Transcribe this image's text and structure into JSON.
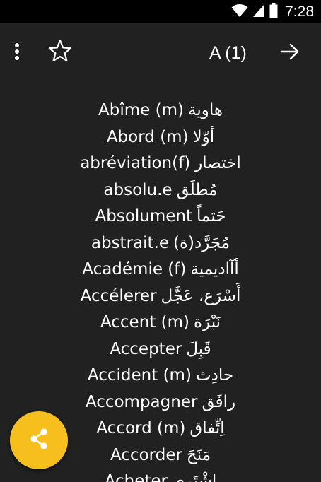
{
  "status_bar": {
    "time": "7:28",
    "icons": [
      "wifi-icon",
      "cell-signal-icon",
      "battery-icon"
    ]
  },
  "toolbar": {
    "menu_icon": "more-vert-icon",
    "favorite_icon": "star-outline-icon",
    "letter_title": "A (1)",
    "next_icon": "arrow-right-icon"
  },
  "words": [
    {
      "fr": "Abîme (m)",
      "ar": "هاوية"
    },
    {
      "fr": "Abord (m)",
      "ar": "أوّلا"
    },
    {
      "fr": "abréviation(f)",
      "ar": "اختصار"
    },
    {
      "fr": "absolu.e",
      "ar": "مُطلَق"
    },
    {
      "fr": "Absolument",
      "ar": "حَتماً"
    },
    {
      "fr": "abstrait.e",
      "ar": "مُجَرَّد(ة)"
    },
    {
      "fr": "Académie (f)",
      "ar": "أآاديمية"
    },
    {
      "fr": "Accélerer",
      "ar": "أَسْرَع، عَجَّل"
    },
    {
      "fr": "Accent (m)",
      "ar": "نَبْرَة"
    },
    {
      "fr": "Accepter",
      "ar": "قَبِلَ"
    },
    {
      "fr": "Accident (m)",
      "ar": "حادِث"
    },
    {
      "fr": "Accompagner",
      "ar": "رافَق"
    },
    {
      "fr": "Accord (m)",
      "ar": "اِتِّفاق"
    },
    {
      "fr": "Accorder",
      "ar": "مَنَحَ"
    },
    {
      "fr": "Acheter",
      "ar": "اِشْتَرى"
    }
  ],
  "fab": {
    "icon": "share-icon",
    "color": "#f7bf1e"
  },
  "colors": {
    "background": "#212121",
    "status_bar": "#000000",
    "text": "#ffffff",
    "accent": "#f7bf1e"
  }
}
